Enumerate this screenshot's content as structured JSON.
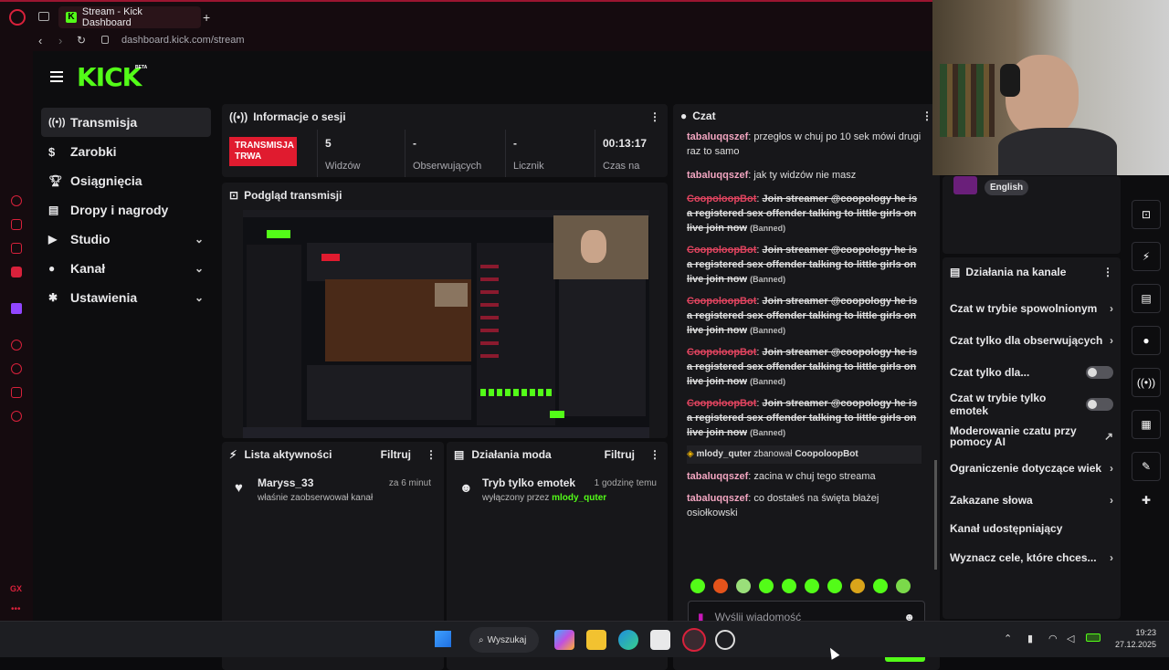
{
  "browser": {
    "tab_title": "Stream - Kick Dashboard",
    "new_tab": "+",
    "url": "dashboard.kick.com/stream"
  },
  "kick": {
    "logo": "KICK",
    "beta": "BETA"
  },
  "sidebar": {
    "items": [
      {
        "label": "Transmisja",
        "icon": "broadcast-icon"
      },
      {
        "label": "Zarobki",
        "icon": "dollar-icon"
      },
      {
        "label": "Osiągnięcia",
        "icon": "trophy-icon"
      },
      {
        "label": "Dropy i nagrody",
        "icon": "gift-icon"
      },
      {
        "label": "Studio",
        "icon": "video-icon"
      },
      {
        "label": "Kanał",
        "icon": "user-icon"
      },
      {
        "label": "Ustawienia",
        "icon": "gear-icon"
      }
    ]
  },
  "session": {
    "title": "Informacje o sesji",
    "live_badge_line1": "TRANSMISJA",
    "live_badge_line2": "TRWA",
    "stats": [
      {
        "value": "5",
        "label": "Widzów"
      },
      {
        "value": "-",
        "label": "Obserwujących"
      },
      {
        "value": "-",
        "label": "Licznik"
      },
      {
        "value": "00:13:17",
        "label": "Czas na"
      }
    ]
  },
  "preview": {
    "title": "Podgląd transmisji"
  },
  "activity": {
    "title": "Lista aktywności",
    "filter": "Filtruj",
    "item_name": "Maryss_33",
    "item_time": "za 6 minut",
    "item_text": "właśnie zaobserwował kanał"
  },
  "mod_actions": {
    "title": "Działania moda",
    "filter": "Filtruj",
    "item_title": "Tryb tylko emotek",
    "item_time": "1 godzinę temu",
    "item_text": "wyłączony przez",
    "item_user": "mlody_quter"
  },
  "chat": {
    "title": "Czat",
    "messages": [
      {
        "user": "tabaluqqszef",
        "text": "przegłos w chuj po 10 sek mówi drugi raz to samo"
      },
      {
        "user": "tabaluqqszef",
        "text": "jak ty widzów nie masz"
      }
    ],
    "banned_user": "CoopoloopBot",
    "banned_text": "Join streamer @coopology he is a registered sex offender talking to little girls on live join now",
    "banned_tag": "(Banned)",
    "ban_notice_user": "mlody_quter",
    "ban_notice_text": "zbanował",
    "ban_notice_target": "CoopoloopBot",
    "after_messages": [
      {
        "user": "tabaluqqszef",
        "text": "zacina w chuj tego streama"
      },
      {
        "user": "tabaluqqszef",
        "text": "co dostałeś na święta błażej osiołkowski"
      }
    ],
    "input_placeholder": "Wyślij wiadomość",
    "send_label": "Czat"
  },
  "channel_actions": {
    "language": "English",
    "title": "Działania na kanale",
    "items": [
      "Czat w trybie spowolnionym",
      "Czat tylko dla obserwujących",
      "Czat tylko dla...",
      "Czat w trybie tylko emotek",
      "Moderowanie czatu przy pomocy AI",
      "Ograniczenie dotyczące wiek",
      "Zakazane słowa",
      "Kanał udostępniający",
      "Wyznacz cele, które chces..."
    ]
  },
  "taskbar": {
    "search": "Wyszukaj",
    "time": "19:23",
    "date": "27.12.2025"
  },
  "colors": {
    "accent": "#53fc18",
    "live_red": "#e01b2f",
    "opera_red": "#9b1530"
  }
}
